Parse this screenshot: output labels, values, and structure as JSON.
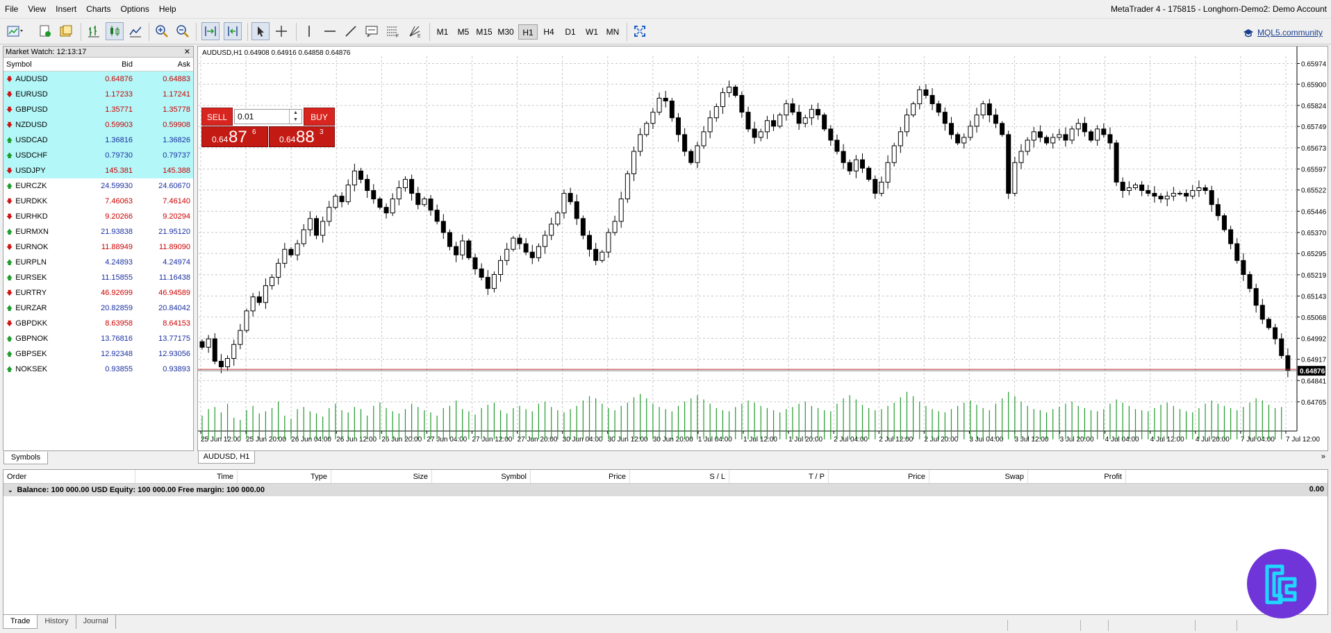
{
  "window_title": "MetaTrader 4 - 175815 - Longhorn-Demo2: Demo Account",
  "menu": [
    "File",
    "View",
    "Insert",
    "Charts",
    "Options",
    "Help"
  ],
  "toolbar": {
    "timeframes": [
      "M1",
      "M5",
      "M15",
      "M30",
      "H1",
      "H4",
      "D1",
      "W1",
      "MN"
    ],
    "active_timeframe": "H1",
    "community_link": "MQL5.community",
    "icons": [
      "new-chart-icon",
      "profiles-icon",
      "templates-icon",
      "market-watch-icon",
      "bar-chart-icon",
      "candle-chart-icon",
      "line-chart-icon",
      "zoom-in-icon",
      "zoom-out-icon",
      "auto-scroll-icon",
      "chart-shift-icon",
      "cursor-icon",
      "crosshair-icon",
      "vertical-line-icon",
      "horizontal-line-icon",
      "trendline-icon",
      "text-icon",
      "fibonacci-icon",
      "gann-icon",
      "fullscreen-icon"
    ]
  },
  "market_watch": {
    "title": "Market Watch: 12:13:17",
    "columns": {
      "symbol": "Symbol",
      "bid": "Bid",
      "ask": "Ask"
    },
    "tab_label": "Symbols",
    "rows": [
      {
        "symbol": "AUDUSD",
        "bid": "0.64876",
        "ask": "0.64883",
        "dir": "down",
        "highlight": true
      },
      {
        "symbol": "EURUSD",
        "bid": "1.17233",
        "ask": "1.17241",
        "dir": "down",
        "highlight": true
      },
      {
        "symbol": "GBPUSD",
        "bid": "1.35771",
        "ask": "1.35778",
        "dir": "down",
        "highlight": true
      },
      {
        "symbol": "NZDUSD",
        "bid": "0.59903",
        "ask": "0.59908",
        "dir": "down",
        "highlight": true
      },
      {
        "symbol": "USDCAD",
        "bid": "1.36816",
        "ask": "1.36826",
        "dir": "up",
        "highlight": true
      },
      {
        "symbol": "USDCHF",
        "bid": "0.79730",
        "ask": "0.79737",
        "dir": "up",
        "highlight": true
      },
      {
        "symbol": "USDJPY",
        "bid": "145.381",
        "ask": "145.388",
        "dir": "down",
        "highlight": true
      },
      {
        "symbol": "EURCZK",
        "bid": "24.59930",
        "ask": "24.60670",
        "dir": "up",
        "highlight": false
      },
      {
        "symbol": "EURDKK",
        "bid": "7.46063",
        "ask": "7.46140",
        "dir": "down",
        "highlight": false
      },
      {
        "symbol": "EURHKD",
        "bid": "9.20266",
        "ask": "9.20294",
        "dir": "down",
        "highlight": false
      },
      {
        "symbol": "EURMXN",
        "bid": "21.93838",
        "ask": "21.95120",
        "dir": "up",
        "highlight": false
      },
      {
        "symbol": "EURNOK",
        "bid": "11.88949",
        "ask": "11.89090",
        "dir": "down",
        "highlight": false
      },
      {
        "symbol": "EURPLN",
        "bid": "4.24893",
        "ask": "4.24974",
        "dir": "up",
        "highlight": false
      },
      {
        "symbol": "EURSEK",
        "bid": "11.15855",
        "ask": "11.16438",
        "dir": "up",
        "highlight": false
      },
      {
        "symbol": "EURTRY",
        "bid": "46.92699",
        "ask": "46.94589",
        "dir": "down",
        "highlight": false
      },
      {
        "symbol": "EURZAR",
        "bid": "20.82859",
        "ask": "20.84042",
        "dir": "up",
        "highlight": false
      },
      {
        "symbol": "GBPDKK",
        "bid": "8.63958",
        "ask": "8.64153",
        "dir": "down",
        "highlight": false
      },
      {
        "symbol": "GBPNOK",
        "bid": "13.76816",
        "ask": "13.77175",
        "dir": "up",
        "highlight": false
      },
      {
        "symbol": "GBPSEK",
        "bid": "12.92348",
        "ask": "12.93056",
        "dir": "up",
        "highlight": false
      },
      {
        "symbol": "NOKSEK",
        "bid": "0.93855",
        "ask": "0.93893",
        "dir": "up",
        "highlight": false
      }
    ]
  },
  "chart": {
    "ohlc_label": "AUDUSD,H1  0.64908 0.64916 0.64858 0.64876",
    "tab_label": "AUDUSD, H1",
    "one_click": {
      "sell_label": "SELL",
      "buy_label": "BUY",
      "lot": "0.01",
      "sell_small": "0.64",
      "sell_big": "87",
      "sell_sup": "6",
      "buy_small": "0.64",
      "buy_big": "88",
      "buy_sup": "3"
    }
  },
  "chart_data": {
    "type": "candlestick",
    "symbol": "AUDUSD",
    "timeframe": "H1",
    "price_ticks": [
      "0.65974",
      "0.65900",
      "0.65824",
      "0.65749",
      "0.65673",
      "0.65597",
      "0.65522",
      "0.65446",
      "0.65370",
      "0.65295",
      "0.65219",
      "0.65143",
      "0.65068",
      "0.64992",
      "0.64917",
      "0.64841",
      "0.64765"
    ],
    "ylim": [
      0.6474,
      0.66
    ],
    "current_price": "0.64876",
    "time_ticks": [
      "25 Jun 12:00",
      "25 Jun 20:00",
      "26 Jun 04:00",
      "26 Jun 12:00",
      "26 Jun 20:00",
      "27 Jun 04:00",
      "27 Jun 12:00",
      "27 Jun 20:00",
      "30 Jun 04:00",
      "30 Jun 12:00",
      "30 Jun 20:00",
      "1 Jul 04:00",
      "1 Jul 12:00",
      "1 Jul 20:00",
      "2 Jul 04:00",
      "2 Jul 12:00",
      "2 Jul 20:00",
      "3 Jul 04:00",
      "3 Jul 12:00",
      "3 Jul 20:00",
      "4 Jul 04:00",
      "4 Jul 12:00",
      "4 Jul 20:00",
      "7 Jul 04:00",
      "7 Jul 12:00"
    ],
    "close_series": [
      0.6496,
      0.6499,
      0.6491,
      0.6489,
      0.6492,
      0.6497,
      0.6502,
      0.6509,
      0.6514,
      0.6512,
      0.6518,
      0.6521,
      0.6526,
      0.6531,
      0.6529,
      0.6533,
      0.6538,
      0.6542,
      0.6536,
      0.6541,
      0.6546,
      0.655,
      0.6548,
      0.6554,
      0.6559,
      0.6556,
      0.6552,
      0.6549,
      0.6546,
      0.6544,
      0.6549,
      0.6553,
      0.6556,
      0.6551,
      0.6547,
      0.6549,
      0.6545,
      0.6541,
      0.6537,
      0.6532,
      0.6529,
      0.6534,
      0.6528,
      0.6524,
      0.6521,
      0.6517,
      0.6522,
      0.6527,
      0.6531,
      0.6535,
      0.6533,
      0.653,
      0.6528,
      0.6532,
      0.6536,
      0.654,
      0.6544,
      0.6551,
      0.6548,
      0.6542,
      0.6536,
      0.6531,
      0.6527,
      0.653,
      0.6537,
      0.6541,
      0.6549,
      0.6558,
      0.6566,
      0.6572,
      0.6576,
      0.658,
      0.6585,
      0.6584,
      0.6578,
      0.6572,
      0.6566,
      0.6562,
      0.6568,
      0.6573,
      0.6578,
      0.6582,
      0.6587,
      0.6589,
      0.6586,
      0.658,
      0.6574,
      0.6571,
      0.6573,
      0.6577,
      0.6575,
      0.6579,
      0.6583,
      0.658,
      0.6576,
      0.6578,
      0.6581,
      0.6579,
      0.6574,
      0.657,
      0.6566,
      0.6562,
      0.6559,
      0.6563,
      0.656,
      0.6556,
      0.6551,
      0.6555,
      0.6562,
      0.6568,
      0.6573,
      0.6579,
      0.6583,
      0.6588,
      0.6586,
      0.6583,
      0.658,
      0.6576,
      0.6572,
      0.6569,
      0.6571,
      0.6575,
      0.6579,
      0.6583,
      0.6579,
      0.6576,
      0.6572,
      0.6551,
      0.6562,
      0.6566,
      0.657,
      0.6573,
      0.6571,
      0.6569,
      0.6571,
      0.6572,
      0.657,
      0.6574,
      0.6576,
      0.6573,
      0.657,
      0.6574,
      0.6572,
      0.6569,
      0.6555,
      0.6552,
      0.6553,
      0.6554,
      0.6552,
      0.6551,
      0.655,
      0.6549,
      0.655,
      0.6551,
      0.6551,
      0.655,
      0.6552,
      0.6553,
      0.6552,
      0.6547,
      0.6543,
      0.6538,
      0.6533,
      0.6527,
      0.6522,
      0.6517,
      0.6511,
      0.6506,
      0.6503,
      0.6499,
      0.6493,
      0.64876
    ],
    "volume_series": [
      22,
      28,
      30,
      25,
      33,
      20,
      18,
      27,
      31,
      24,
      26,
      29,
      35,
      22,
      19,
      28,
      30,
      26,
      24,
      21,
      29,
      33,
      27,
      25,
      30,
      28,
      22,
      31,
      34,
      29,
      26,
      24,
      28,
      33,
      30,
      27,
      25,
      22,
      29,
      31,
      36,
      28,
      26,
      23,
      29,
      32,
      34,
      27,
      24,
      29,
      31,
      28,
      26,
      33,
      35,
      30,
      27,
      25,
      28,
      31,
      36,
      40,
      38,
      33,
      29,
      27,
      31,
      34,
      39,
      42,
      38,
      33,
      30,
      28,
      26,
      31,
      35,
      38,
      41,
      37,
      33,
      29,
      27,
      26,
      30,
      33,
      36,
      34,
      31,
      29,
      27,
      25,
      28,
      30,
      33,
      35,
      31,
      29,
      27,
      26,
      33,
      38,
      41,
      37,
      32,
      29,
      27,
      28,
      31,
      34,
      39,
      44,
      40,
      35,
      31,
      28,
      26,
      25,
      28,
      31,
      34,
      36,
      32,
      29,
      27,
      33,
      38,
      44,
      40,
      35,
      31,
      28,
      27,
      25,
      28,
      30,
      33,
      35,
      31,
      29,
      27,
      26,
      28,
      33,
      37,
      34,
      31,
      28,
      27,
      26,
      29,
      32,
      34,
      31,
      28,
      26,
      25,
      29,
      33,
      36,
      33,
      31,
      29,
      27,
      30,
      34,
      38,
      36,
      32,
      29,
      30
    ]
  },
  "terminal": {
    "columns": [
      "Order",
      "Time",
      "Type",
      "Size",
      "Symbol",
      "Price",
      "S / L",
      "T / P",
      "Price",
      "Swap",
      "Profit"
    ],
    "balance_text": "Balance: 100 000.00 USD  Equity: 100 000.00  Free margin: 100 000.00",
    "profit": "0.00",
    "tabs": [
      "Trade",
      "History",
      "Journal"
    ]
  }
}
